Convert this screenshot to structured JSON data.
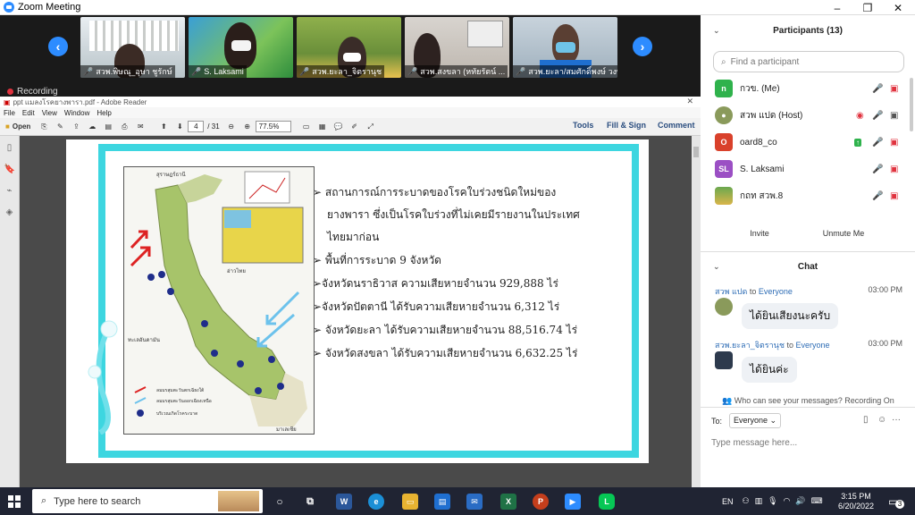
{
  "window": {
    "title": "Zoom Meeting",
    "minimize": "–",
    "maximize": "❐",
    "close": "✕"
  },
  "recording": "Recording",
  "video_tiles": [
    {
      "name": "สวพ.พิษณุ_อุษา ชูรักษ์"
    },
    {
      "name": "S. Laksami"
    },
    {
      "name": "สวพ.ยะลา_จิตรานุช"
    },
    {
      "name": "สวพ.สงขลา (หทัยรัตน์ ..."
    },
    {
      "name": "สวพ.ยะลา/สมศักดิ์พงษ์ วงษ์..."
    }
  ],
  "reader": {
    "title": "ppt แมลงโรคยางพารา.pdf - Adobe Reader",
    "menu": [
      "File",
      "Edit",
      "View",
      "Window",
      "Help"
    ],
    "open": "Open",
    "page_current": "4",
    "page_total": "/ 31",
    "zoom": "77.5%",
    "tools": "Tools",
    "fill_sign": "Fill & Sign",
    "comment": "Comment"
  },
  "slide": {
    "bullets": [
      "➢  สถานการณ์การระบาดของโรคใบร่วงชนิดใหม่ของ",
      "ยางพารา ซึ่งเป็นโรคใบร่วงที่ไม่เคยมีรายงานในประเทศ",
      "ไทยมาก่อน",
      "➢  พื้นที่การระบาด 9 จังหวัด",
      "➢จังหวัดนราธิวาส ความเสียหายจำนวน 929,888  ไร่",
      "➢จังหวัดปัตตานี ได้รับความเสียหายจำนวน 6,312 ไร่",
      "➢ จังหวัดยะลา ได้รับความเสียหายจำนวน 88,516.74  ไร่",
      "➢ จังหวัดสงขลา ได้รับความเสียหายจำนวน 6,632.25 ไร่"
    ],
    "map_labels": {
      "top": "สุราษฎร์ธานี",
      "gulf": "อ่าวไทย",
      "sea": "ทะเลอันดามัน",
      "bottom": "มาเลเซีย"
    },
    "legend": [
      "ลมมรสุมตะวันตกเฉียงใต้",
      "ลมมรสุมตะวันออกเฉียงเหนือ",
      "บริเวณเกิดโรคระบาด"
    ]
  },
  "participants": {
    "header": "Participants (13)",
    "search_placeholder": "Find a participant",
    "list": [
      {
        "initial": "n",
        "name": "กวข. (Me)",
        "color": "#2fb24c"
      },
      {
        "initial": "",
        "name": "สวพ แปด (Host)",
        "color": "#8a9a5b"
      },
      {
        "initial": "O",
        "name": "oard8_co",
        "color": "#d9412b"
      },
      {
        "initial": "SL",
        "name": "S. Laksami",
        "color": "#9b4fc4"
      },
      {
        "initial": "",
        "name": "กถท สวพ.8",
        "color": "#6aa84f"
      }
    ],
    "invite": "Invite",
    "unmute": "Unmute Me"
  },
  "chat": {
    "header": "Chat",
    "messages": [
      {
        "from": "สวพ แปด",
        "to": "to",
        "target": "Everyone",
        "time": "03:00 PM",
        "text": "ได้ยินเสียงนะครับ"
      },
      {
        "from": "สวพ.ยะลา_จิตรานุช",
        "to": "to",
        "target": "Everyone",
        "time": "03:00 PM",
        "text": "ได้ยินค่ะ"
      }
    ],
    "who_can_see": "Who can see your messages? Recording On",
    "to_label": "To:",
    "recipient": "Everyone",
    "placeholder": "Type message here..."
  },
  "taskbar": {
    "search_placeholder": "Type here to search",
    "lang": "EN",
    "time": "3:15 PM",
    "date": "6/20/2022",
    "notif": "3"
  }
}
